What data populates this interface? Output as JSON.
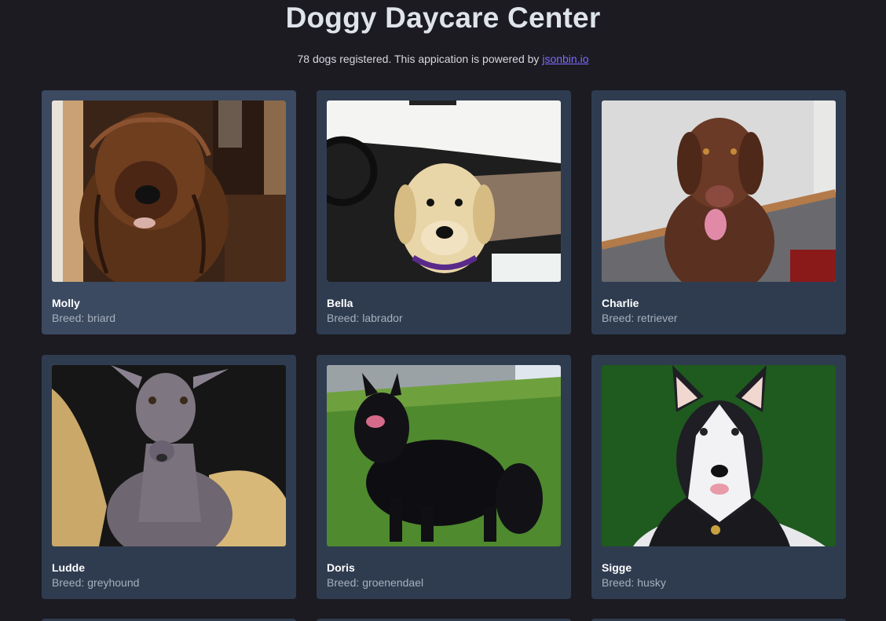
{
  "header": {
    "title": "Doggy Daycare Center",
    "subtitle_text": "78 dogs registered. This appication is powered by",
    "link_text": "jsonbin.io"
  },
  "breed_label": "Breed:",
  "dogs": [
    {
      "name": "Molly",
      "breed": "briard"
    },
    {
      "name": "Bella",
      "breed": "labrador"
    },
    {
      "name": "Charlie",
      "breed": "retriever"
    },
    {
      "name": "Ludde",
      "breed": "greyhound"
    },
    {
      "name": "Doris",
      "breed": "groenendael"
    },
    {
      "name": "Sigge",
      "breed": "husky"
    }
  ],
  "colors": {
    "background": "#1c1b22",
    "card": "#2f3c50",
    "card_hover": "#3b4a60",
    "link": "#7c6cff"
  }
}
